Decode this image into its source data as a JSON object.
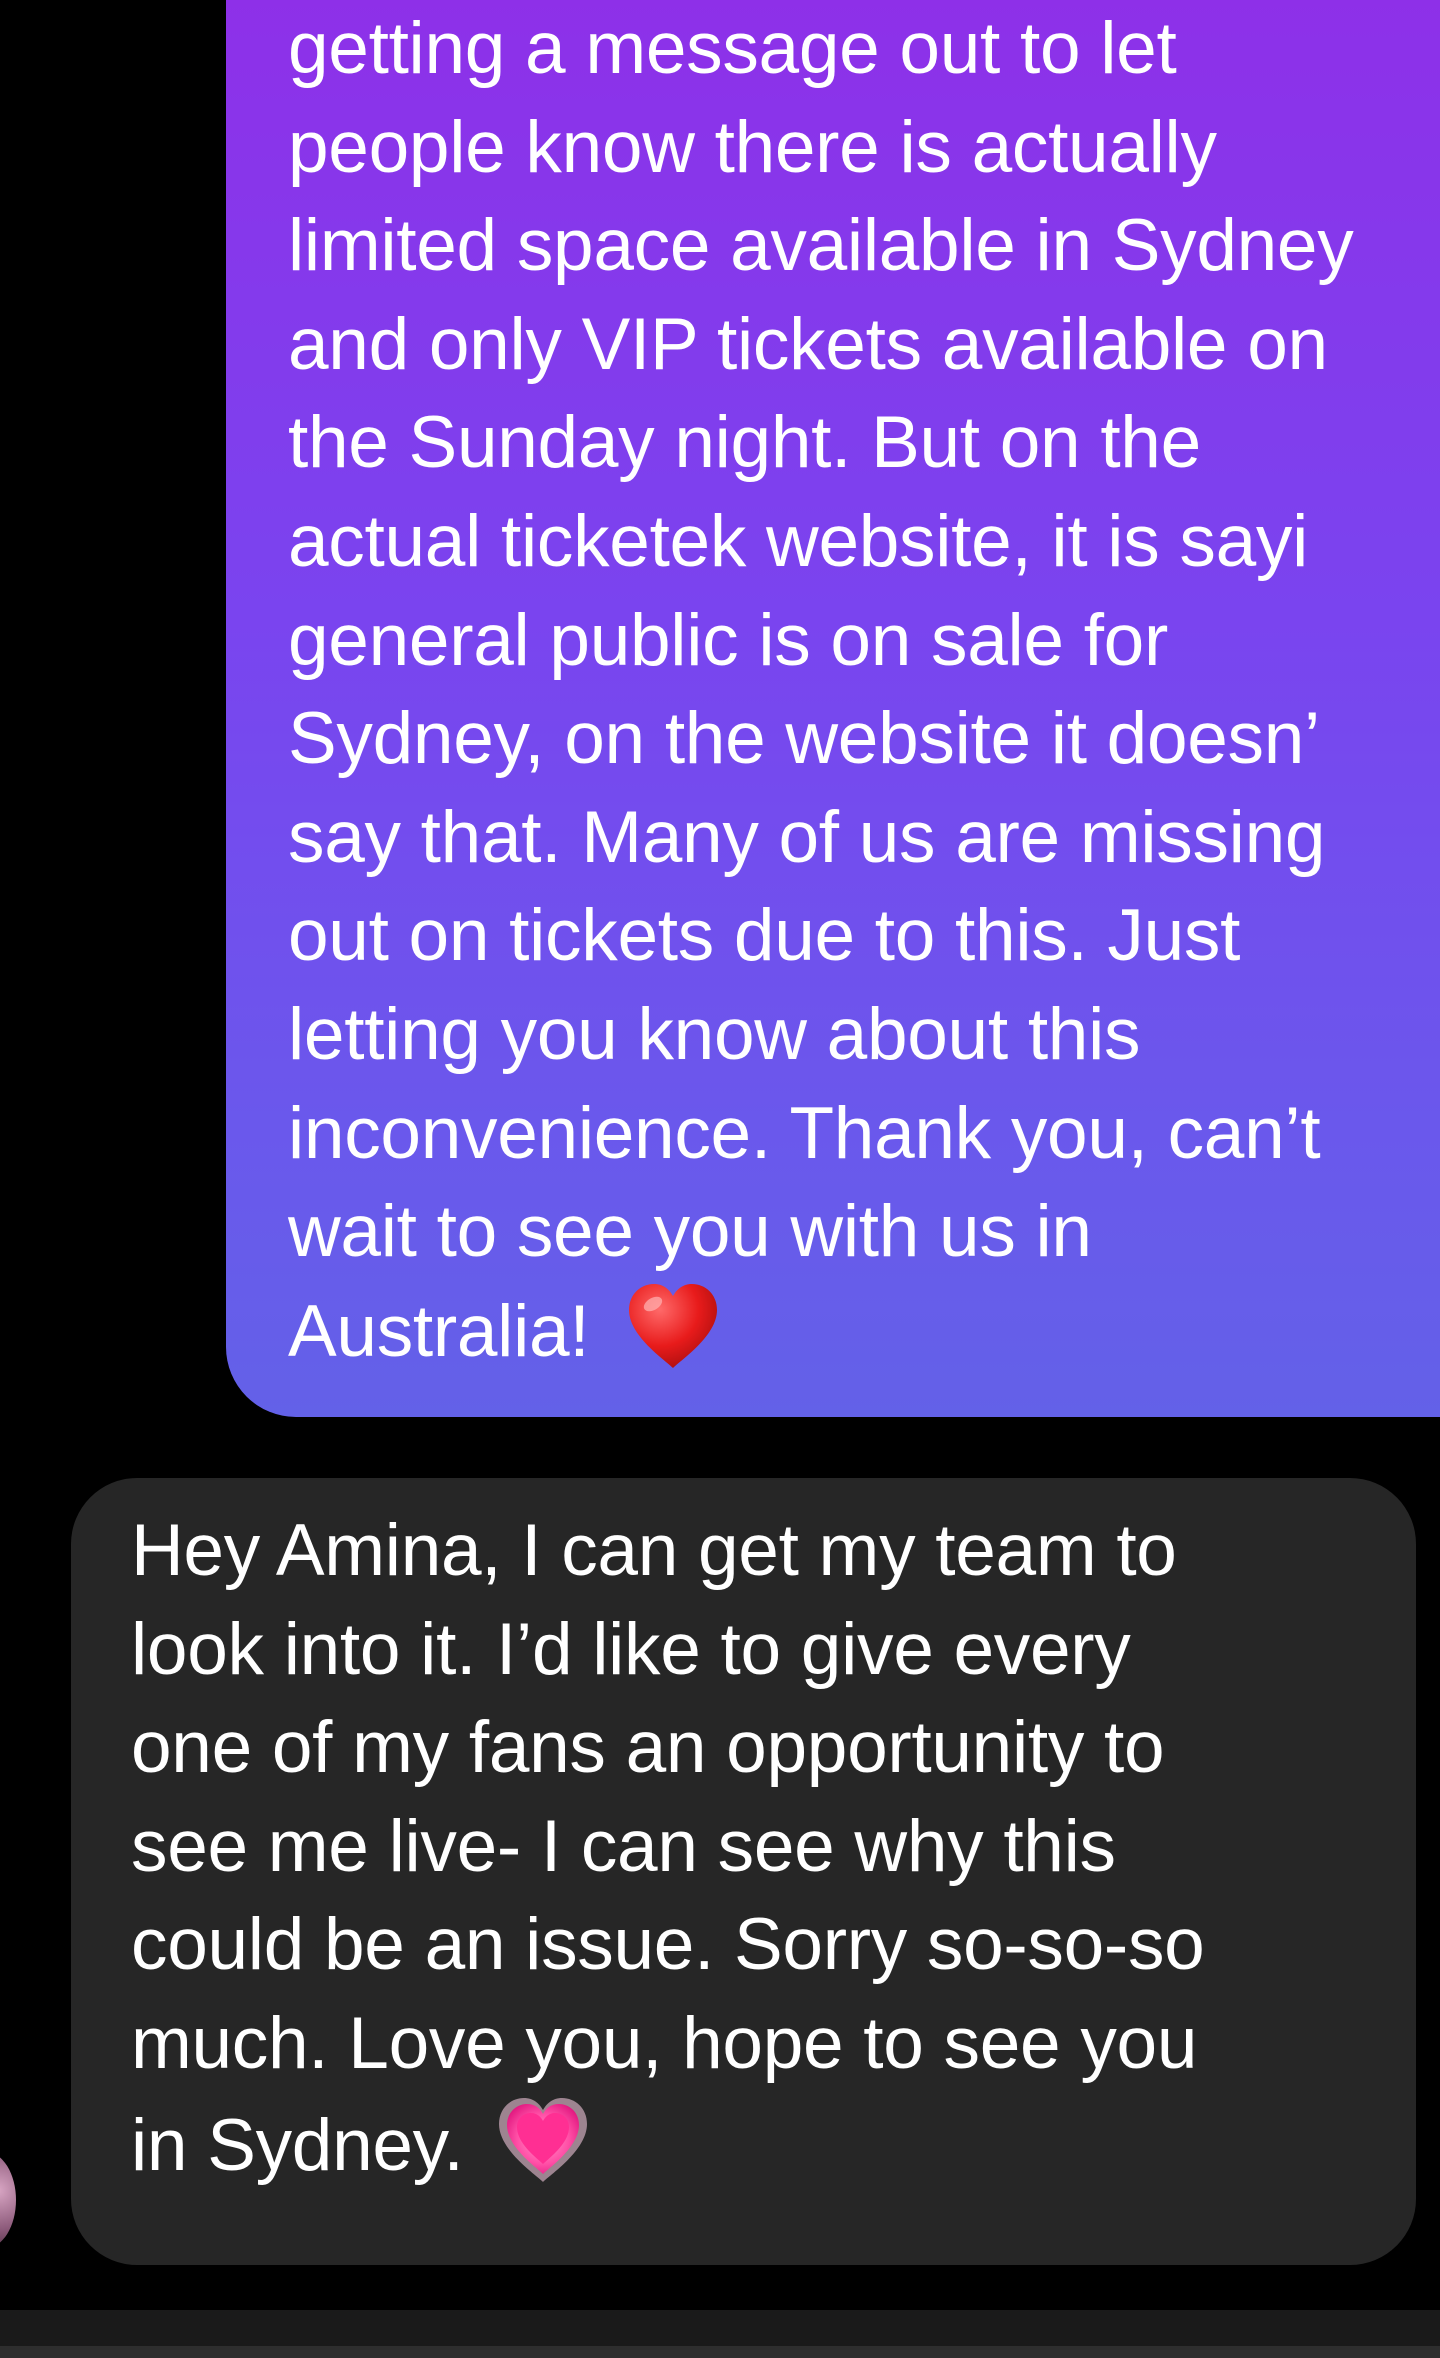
{
  "conversation": {
    "sent_message": {
      "lines": [
        "getting a message out to let",
        "people know there is actually",
        "limited space available in Sydney",
        "and only VIP tickets available on",
        "the Sunday night. But on the",
        "actual ticketek website, it is sayi",
        "general public is on sale for",
        "Sydney, on the website it doesn’",
        "say that. Many of us are missing",
        "out on tickets due to this. Just",
        "letting you know about this",
        "inconvenience. Thank you, can’t",
        "wait to see you with us in",
        "Australia!"
      ],
      "emoji": "red-heart-icon",
      "gradient_colors": [
        "#8f2fe8",
        "#6361e8"
      ]
    },
    "received_message": {
      "lines": [
        "Hey Amina, I can get my team to",
        "look into it. I’d like to give every",
        "one of my fans an opportunity to",
        "see me live- I can see why this",
        "could be an issue. Sorry so-so-so",
        "much. Love you, hope to see you",
        "in Sydney."
      ],
      "emoji": "pink-heart-icon",
      "bubble_color": "#262626"
    }
  }
}
